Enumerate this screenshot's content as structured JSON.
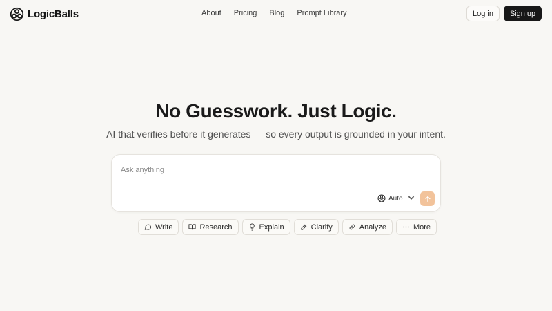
{
  "brand": {
    "name": "LogicBalls"
  },
  "nav": {
    "items": [
      {
        "label": "About"
      },
      {
        "label": "Pricing"
      },
      {
        "label": "Blog"
      },
      {
        "label": "Prompt Library"
      }
    ]
  },
  "auth": {
    "login_label": "Log in",
    "signup_label": "Sign up"
  },
  "hero": {
    "title": "No Guesswork. Just Logic.",
    "subtitle": "AI that verifies before it generates — so every output is grounded in your intent."
  },
  "prompt": {
    "placeholder": "Ask anything",
    "value": "",
    "model": {
      "label": "Auto",
      "icon": "logicballs-logo-icon"
    },
    "send_icon": "arrow-up-icon"
  },
  "actions": [
    {
      "label": "Write",
      "icon": "chat-bubble-icon"
    },
    {
      "label": "Research",
      "icon": "book-icon"
    },
    {
      "label": "Explain",
      "icon": "lightbulb-icon"
    },
    {
      "label": "Clarify",
      "icon": "pencil-icon"
    },
    {
      "label": "Analyze",
      "icon": "link-icon"
    },
    {
      "label": "More",
      "icon": "ellipsis-icon"
    }
  ],
  "colors": {
    "background": "#f8f7f4",
    "send_button": "#f2c39b",
    "signup_button": "#181818"
  }
}
